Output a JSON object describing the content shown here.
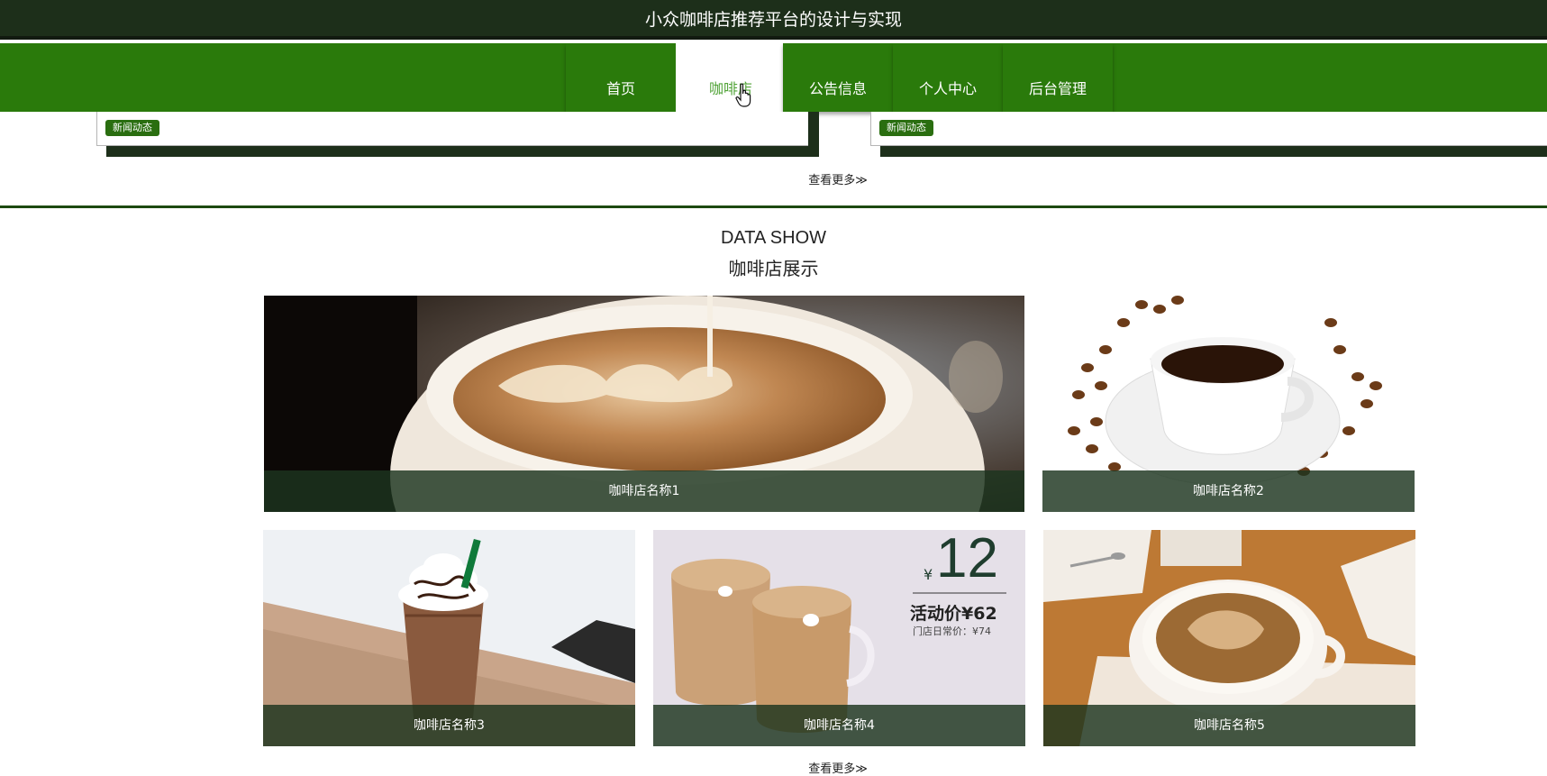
{
  "header": {
    "title": "小众咖啡店推荐平台的设计与实现"
  },
  "nav": {
    "items": [
      {
        "label": "首页"
      },
      {
        "label": "咖啡店"
      },
      {
        "label": "公告信息"
      },
      {
        "label": "个人中心"
      },
      {
        "label": "后台管理"
      }
    ],
    "active_index": 1
  },
  "news": {
    "badges": [
      "新闻动态",
      "新闻动态"
    ],
    "more": "查看更多≫"
  },
  "showcase": {
    "title_en": "DATA SHOW",
    "title_cn": "咖啡店展示",
    "cards": [
      {
        "name": "咖啡店名称1"
      },
      {
        "name": "咖啡店名称2"
      },
      {
        "name": "咖啡店名称3"
      },
      {
        "name": "咖啡店名称4",
        "promo": {
          "currency": "¥",
          "price": "12",
          "activity": "活动价¥62",
          "regular": "门店日常价：¥74"
        }
      },
      {
        "name": "咖啡店名称5"
      }
    ],
    "more": "查看更多≫"
  },
  "colors": {
    "header_bg": "#1d2f1a",
    "nav_bg": "#2a7a0b",
    "accent": "#53a43a",
    "caption_bg": "#1c341e"
  }
}
